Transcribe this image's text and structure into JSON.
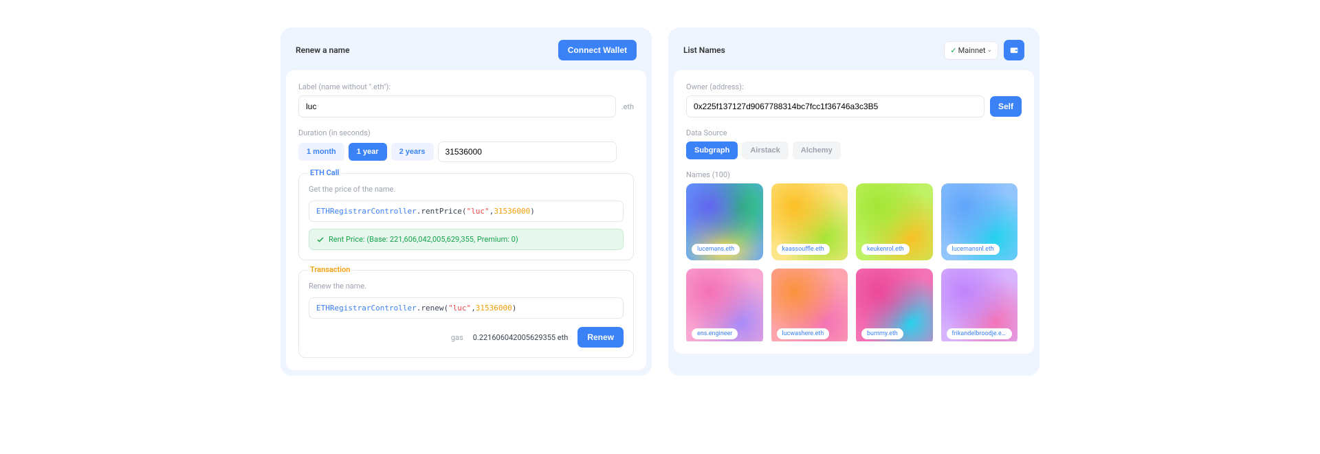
{
  "left": {
    "title": "Renew a name",
    "connect": "Connect Wallet",
    "label_field": {
      "label": "Label (name without \".eth\"):",
      "value": "luc",
      "suffix": ".eth"
    },
    "duration_field": {
      "label": "Duration (in seconds)",
      "presets": [
        {
          "label": "1 month",
          "active": false
        },
        {
          "label": "1 year",
          "active": true
        },
        {
          "label": "2 years",
          "active": false
        }
      ],
      "value": "31536000"
    },
    "eth_call": {
      "title": "ETH Call",
      "sub": "Get the price of the name.",
      "code": {
        "obj": "ETHRegistrarController",
        "fn": ".rentPrice(",
        "arg1": "\"luc\"",
        "sep": ", ",
        "arg2": "31536000",
        "close": ")"
      },
      "result": "Rent Price: (Base: 221,606,042,005,629,355, Premium: 0)"
    },
    "tx": {
      "title": "Transaction",
      "sub": "Renew the name.",
      "code": {
        "obj": "ETHRegistrarController",
        "fn": ".renew(",
        "arg1": "\"luc\"",
        "sep": ", ",
        "arg2": "31536000",
        "close": ")"
      },
      "gas_label": "gas",
      "gas_value": "0.221606042005629355 eth",
      "button": "Renew"
    }
  },
  "right": {
    "title": "List Names",
    "network": "Mainnet",
    "owner_field": {
      "label": "Owner (address):",
      "value": "0x225f137127d9067788314bc7fcc1f36746a3c3B5",
      "self": "Self"
    },
    "datasource": {
      "label": "Data Source",
      "options": [
        {
          "label": "Subgraph",
          "state": "active"
        },
        {
          "label": "Airstack",
          "state": "muted"
        },
        {
          "label": "Alchemy",
          "state": "muted"
        }
      ]
    },
    "names_label": "Names (100)",
    "names": [
      {
        "label": "lucemans.eth",
        "g": "g1"
      },
      {
        "label": "kaassouffle.eth",
        "g": "g2"
      },
      {
        "label": "keukenrol.eth",
        "g": "g3"
      },
      {
        "label": "lucemansnl.eth",
        "g": "g4"
      },
      {
        "label": "ens.engineer",
        "g": "g5"
      },
      {
        "label": "lucwashere.eth",
        "g": "g6"
      },
      {
        "label": "burnmy.eth",
        "g": "g7"
      },
      {
        "label": "frikandelbroodje.eth",
        "g": "g8"
      }
    ]
  }
}
